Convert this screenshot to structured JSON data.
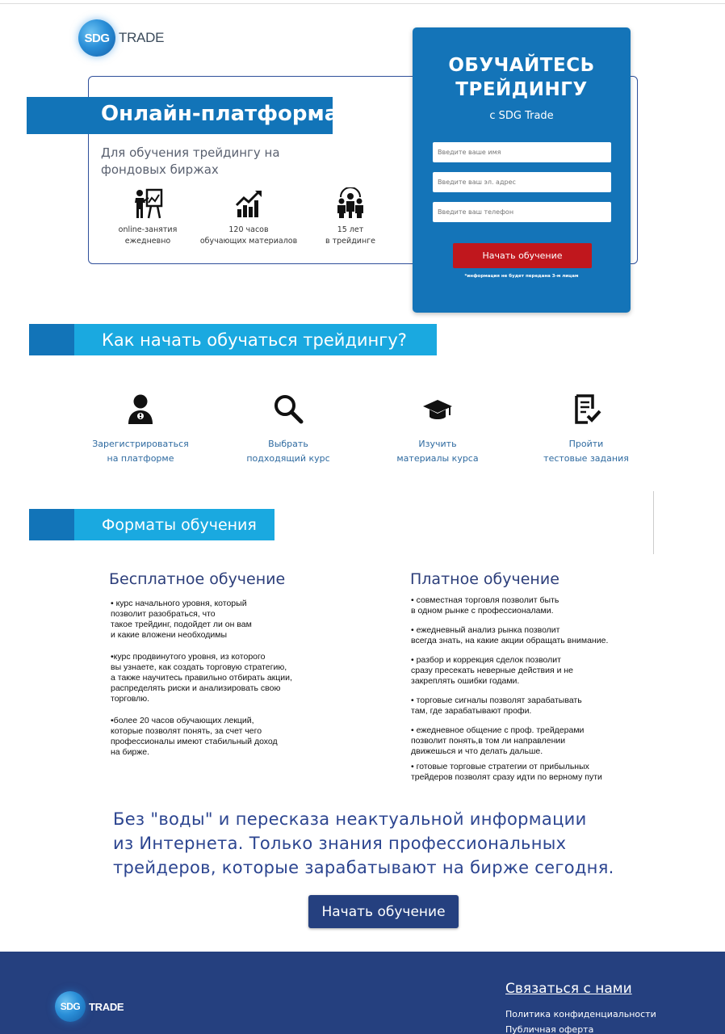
{
  "brand": {
    "logo_mark": "SDG",
    "logo_word": "TRADE"
  },
  "hero": {
    "title": "Онлайн-платформа",
    "subtitle_line1": "Для обучения трейдингу на",
    "subtitle_line2": "фондовых биржах",
    "features": [
      {
        "icon": "teacher-board-icon",
        "line1": "online-занятия",
        "line2": "ежедневно"
      },
      {
        "icon": "growth-chart-icon",
        "line1": "120 часов",
        "line2": "обучающих материалов"
      },
      {
        "icon": "team-icon",
        "line1": "15 лет",
        "line2": "в трейдинге"
      }
    ]
  },
  "signup": {
    "title_line1": "ОБУЧАЙТЕСЬ",
    "title_line2": "ТРЕЙДИНГУ",
    "subtitle": "с SDG Trade",
    "name_placeholder": "Введите ваше имя",
    "email_placeholder": "Введите ваш эл. адрес",
    "phone_placeholder": "Введите ваш телефон",
    "submit_label": "Начать обучение",
    "note": "*информация не будет передана 3-м лицам"
  },
  "how_to": {
    "heading": "Как начать обучаться трейдингу?",
    "steps": [
      {
        "icon": "user-icon",
        "line1": "Зарегистрироваться",
        "line2": "на платформе"
      },
      {
        "icon": "search-icon",
        "line1": "Выбрать",
        "line2": "подходящий курс"
      },
      {
        "icon": "graduation-cap-icon",
        "line1": "Изучить",
        "line2": "материалы курса"
      },
      {
        "icon": "checklist-icon",
        "line1": "Пройти",
        "line2": "тестовые задания"
      }
    ]
  },
  "formats": {
    "heading": "Форматы обучения",
    "free": {
      "title": "Бесплатное обучение",
      "items": [
        "• курс начального уровня, который\nпозволит разобраться, что\nтакое трейдинг, подойдет ли он вам\nи какие вложени необходимы",
        "•курс продвинутого уровня, из которого\nвы узнаете, как создать торговую стратегию,\nа также научитесь правильно отбирать акции,\nраспределять риски и анализировать свою\nторговлю.",
        "•более 20 часов обучающих лекций,\nкоторые позволят понять, за счет чего\nпрофессионалы имеют стабильный доход\nна бирже."
      ]
    },
    "paid": {
      "title": "Платное обучение",
      "items": [
        "• совместная торговля позволит быть\nв одном рынке с профессионалами.",
        "• ежедневный анализ рынка позволит\nвсегда знать, на какие акции обращать внимание.",
        "• разбор и коррекция сделок позволит\nсразу пресекать неверные действия и не\nзакреплять ошибки годами.",
        "• торговые сигналы позволят зарабатывать\nтам, где зарабатывают профи.",
        "• ежедневное общение с проф. трейдерами\nпозволит понять,в том ли направлении\nдвижешься и что делать дальше.",
        "• готовые торговые стратегии от прибыльных\nтрейдеров позволят сразу идти по верному пути"
      ]
    }
  },
  "statement": {
    "line1": "Без \"воды\" и пересказа неактуальной информации",
    "line2": "из Интернета. Только знания профессиональных",
    "line3": "трейдеров, которые зарабатывают на бирже сегодня."
  },
  "cta": {
    "label": "Начать обучение"
  },
  "footer": {
    "contact": "Связаться с нами",
    "privacy": "Политика конфиденциальности",
    "offer": "Публичная оферта"
  },
  "colors": {
    "primary": "#1474b8",
    "accent": "#1aa9e0",
    "navy": "#25407f",
    "danger": "#c0171d"
  }
}
